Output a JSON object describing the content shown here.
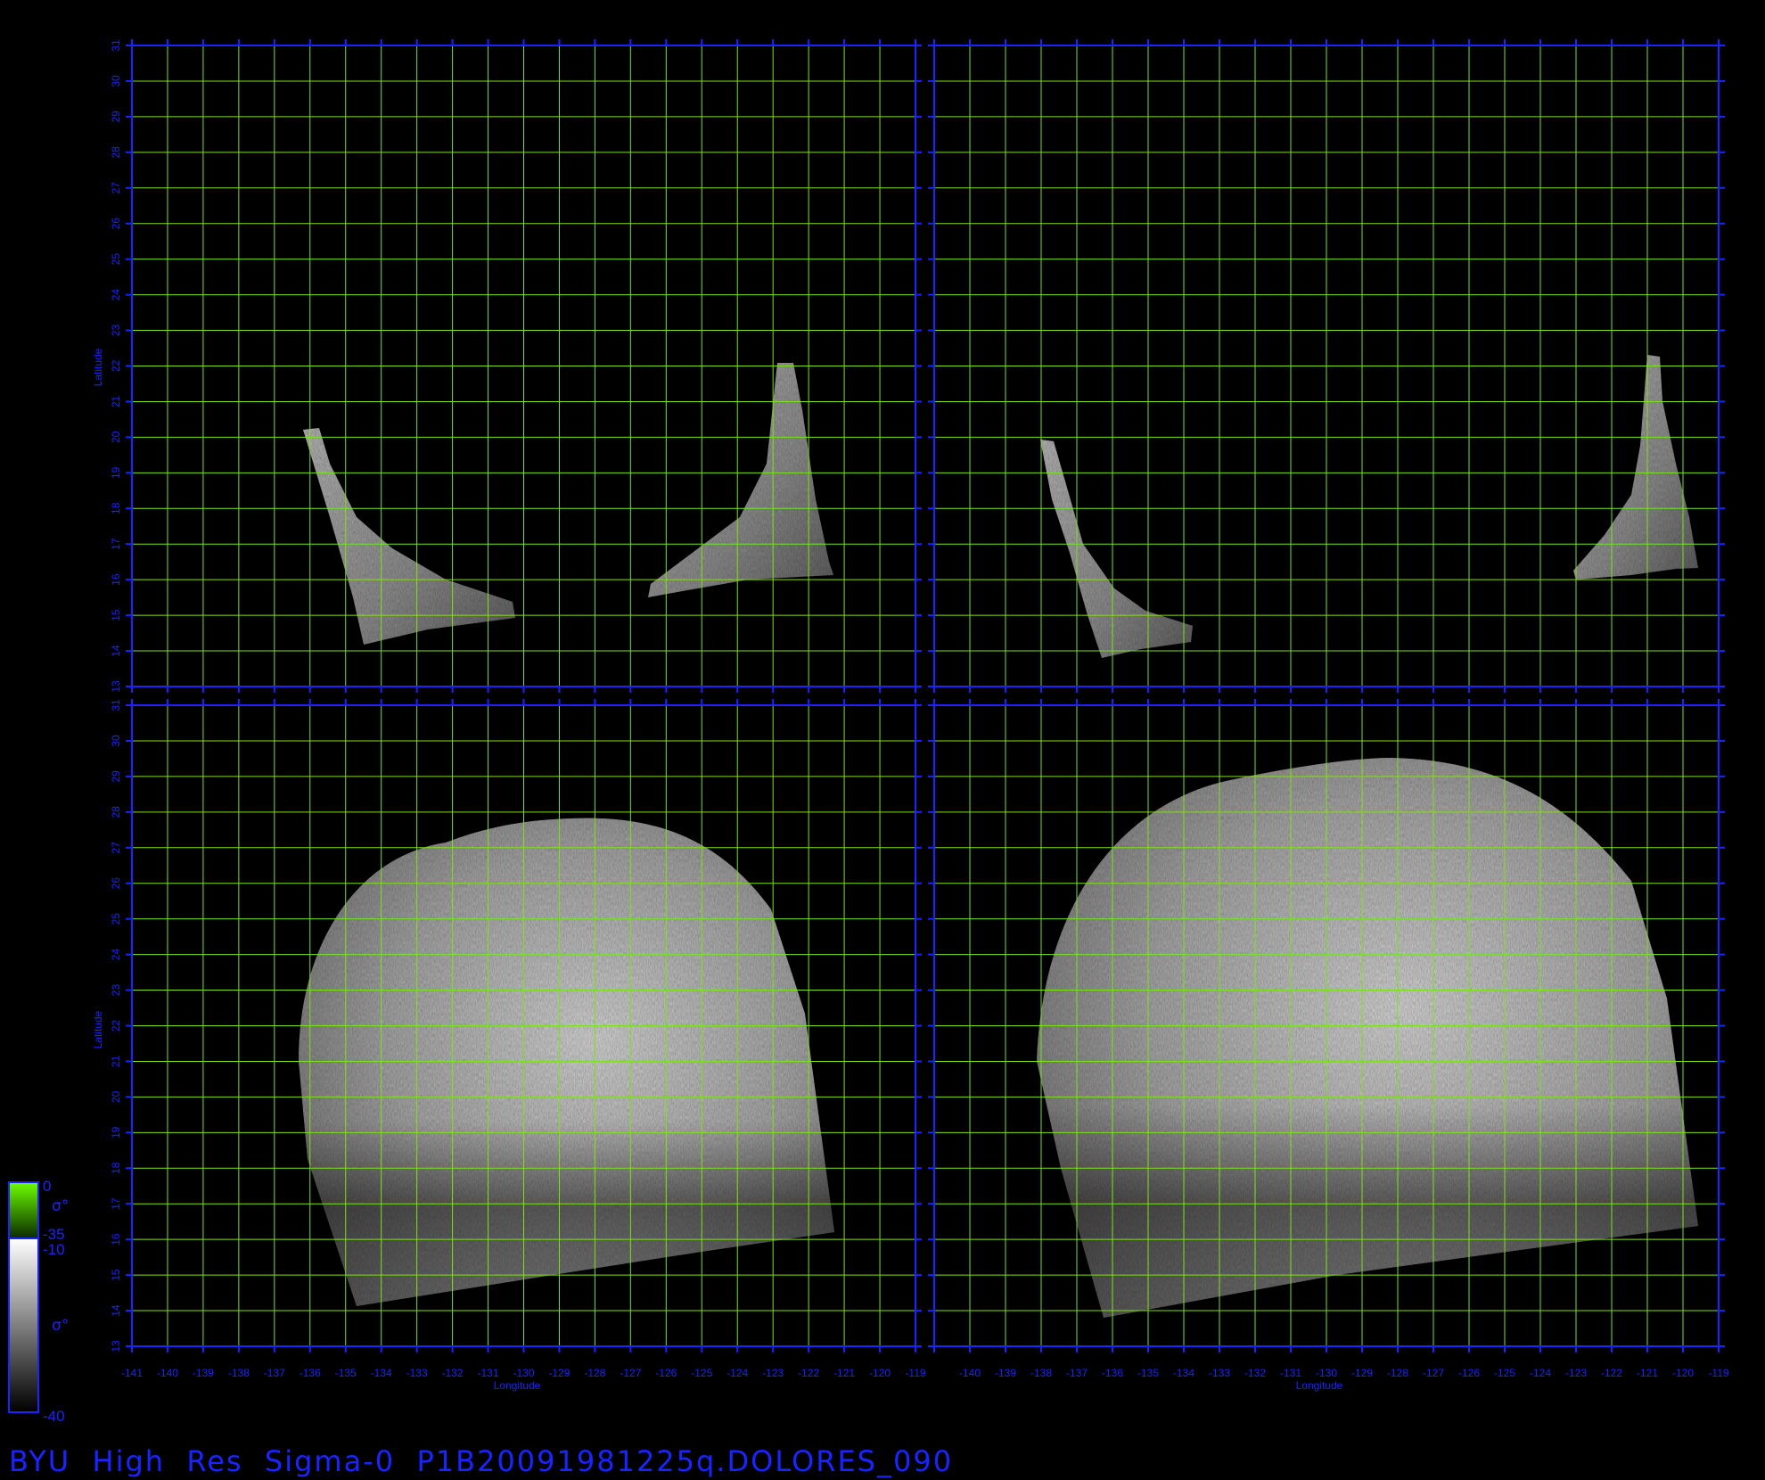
{
  "caption": "BYU  High  Res  Sigma-0  P1B20091981225q.DOLORES_090",
  "axes": {
    "xlabel": "Longitude",
    "ylabel": "Latitude",
    "lon_range": [
      -141,
      -119
    ],
    "lat_range": [
      13,
      31
    ],
    "lon_ticks_left": [
      "-141",
      "-140",
      "-139",
      "-138",
      "-137",
      "-136",
      "-135",
      "-134",
      "-133",
      "-132",
      "-131",
      "-130",
      "-129",
      "-128",
      "-127",
      "-126",
      "-125",
      "-124",
      "-123",
      "-122",
      "-121",
      "-120",
      "-119"
    ],
    "lon_ticks_right": [
      "-140",
      "-139",
      "-138",
      "-137",
      "-136",
      "-135",
      "-134",
      "-133",
      "-132",
      "-131",
      "-130",
      "-129",
      "-128",
      "-127",
      "-126",
      "-125",
      "-124",
      "-123",
      "-122",
      "-121",
      "-120",
      "-119"
    ],
    "lat_ticks": [
      "13",
      "14",
      "15",
      "16",
      "17",
      "18",
      "19",
      "20",
      "21",
      "22",
      "23",
      "24",
      "25",
      "26",
      "27",
      "28",
      "29",
      "30",
      "31"
    ]
  },
  "colorbars": {
    "green": {
      "top_label": "0",
      "symbol": "σ°",
      "bottom_label": "-35"
    },
    "gray": {
      "top_label": "-10",
      "symbol": "σ°",
      "bottom_label": "-40"
    }
  },
  "colors": {
    "axis": "#1a24ff",
    "grid": "#7ee01c",
    "swath_light": "#cfcfcf",
    "swath_dark": "#4a4a4a",
    "background": "#000000"
  }
}
